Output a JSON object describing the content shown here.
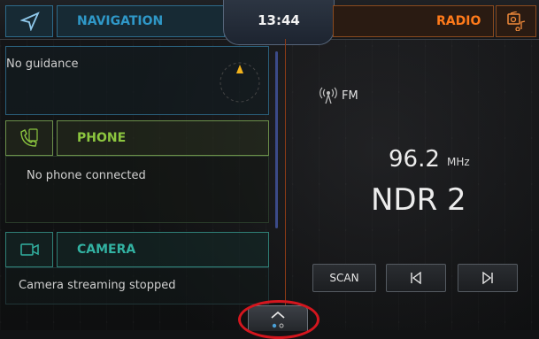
{
  "header": {
    "navigation_label": "NAVIGATION",
    "clock": "13:44",
    "radio_label": "RADIO"
  },
  "navigation": {
    "status": "No guidance"
  },
  "phone": {
    "title": "PHONE",
    "status": "No phone connected"
  },
  "camera": {
    "title": "CAMERA",
    "status": "Camera streaming stopped"
  },
  "radio": {
    "band": "FM",
    "frequency": "96.2",
    "frequency_unit": "MHz",
    "station": "NDR 2",
    "scan_label": "SCAN"
  },
  "colors": {
    "navigation_accent": "#2f98c8",
    "phone_accent": "#8cc63f",
    "camera_accent": "#32b2a2",
    "radio_accent": "#ff7a1a",
    "highlight_ring": "#d4161e"
  },
  "icons": [
    "navigation-arrow-icon",
    "radio-music-icon",
    "phone-device-icon",
    "camera-icon",
    "antenna-icon",
    "skip-back-icon",
    "skip-forward-icon",
    "chevron-up-icon",
    "page-dots-icon"
  ]
}
